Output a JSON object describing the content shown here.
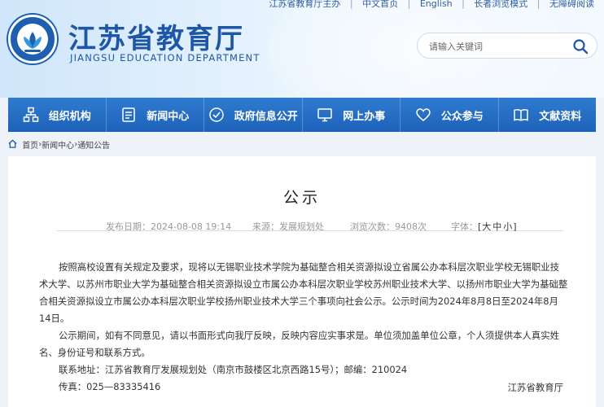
{
  "topbar": {
    "sponsor": "江苏省教育厅主办",
    "links": [
      "中文首页",
      "English",
      "长者浏览模式",
      "无障碍阅读"
    ]
  },
  "site": {
    "title": "江苏省教育厅",
    "subtitle": "JIANGSU EDUCATION DEPARTMENT"
  },
  "search": {
    "placeholder": "请输入关键词",
    "icon": "search-icon"
  },
  "nav": {
    "items": [
      {
        "label": "组织机构",
        "icon": "org-chart-icon"
      },
      {
        "label": "新闻中心",
        "icon": "news-document-icon"
      },
      {
        "label": "政府信息公开",
        "icon": "info-disclosure-icon"
      },
      {
        "label": "网上办事",
        "icon": "monitor-icon"
      },
      {
        "label": "公众参与",
        "icon": "heart-icon"
      },
      {
        "label": "文献资料",
        "icon": "book-icon"
      }
    ]
  },
  "breadcrumb": {
    "items": [
      "首页",
      "新闻中心",
      "通知公告"
    ],
    "separator": "›"
  },
  "article": {
    "title": "公示",
    "date_label": "发布日期：",
    "date": "2024-08-08 19:14",
    "source_label": "来源：",
    "source": "发展规划处",
    "views_label": "浏览次数：",
    "views": "9408次",
    "fontsize_label": "字体：",
    "fontsize_options": [
      "大",
      "中",
      "小"
    ],
    "paragraphs": [
      "按照高校设置有关规定及要求，现将以无锡职业技术学院为基础整合相关资源拟设立省属公办本科层次职业学校无锡职业技术大学、以苏州市职业大学为基础整合相关资源拟设立市属公办本科层次职业学校苏州职业技术大学、以扬州市职业大学为基础整合相关资源拟设立市属公办本科层次职业学校扬州职业技术大学三个事项向社会公示。公示时间为2024年8月8日至2024年8月14日。",
      "公示期间，如有不同意见，请以书面形式向我厅反映，反映内容应实事求是。单位须加盖单位公章，个人须提供本人真实姓名、身份证号和联系方式。",
      "联系地址：江苏省教育厅发展规划处（南京市鼓楼区北京西路15号）；邮编：210024",
      "传真：025—83335416"
    ],
    "signature": "江苏省教育厅"
  },
  "colors": {
    "primary": "#1f57a8",
    "nav": "#1d62b8",
    "background": "#eef3f9"
  }
}
